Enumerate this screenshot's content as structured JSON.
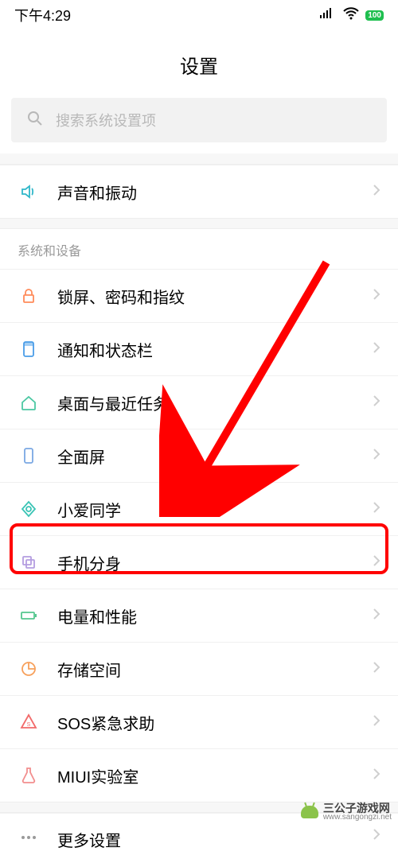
{
  "status": {
    "time": "下午4:29",
    "battery": "100"
  },
  "header": {
    "title": "设置"
  },
  "search": {
    "placeholder": "搜索系统设置项"
  },
  "top_items": [
    {
      "label": "声音和振动",
      "icon": "sound-icon"
    }
  ],
  "section": {
    "header": "系统和设备"
  },
  "items": [
    {
      "label": "锁屏、密码和指纹",
      "icon": "lock-icon"
    },
    {
      "label": "通知和状态栏",
      "icon": "notification-icon"
    },
    {
      "label": "桌面与最近任务",
      "icon": "home-icon"
    },
    {
      "label": "全面屏",
      "icon": "fullscreen-icon"
    },
    {
      "label": "小爱同学",
      "icon": "xiaoai-icon"
    },
    {
      "label": "手机分身",
      "icon": "clone-icon"
    },
    {
      "label": "电量和性能",
      "icon": "battery-icon"
    },
    {
      "label": "存储空间",
      "icon": "storage-icon"
    },
    {
      "label": "SOS紧急求助",
      "icon": "sos-icon"
    },
    {
      "label": "MIUI实验室",
      "icon": "lab-icon"
    },
    {
      "label": "更多设置",
      "icon": "more-icon"
    }
  ],
  "watermark": {
    "title": "三公子游戏网",
    "url": "www.sangongzi.net"
  },
  "annotation": {
    "highlighted_index": 5
  }
}
